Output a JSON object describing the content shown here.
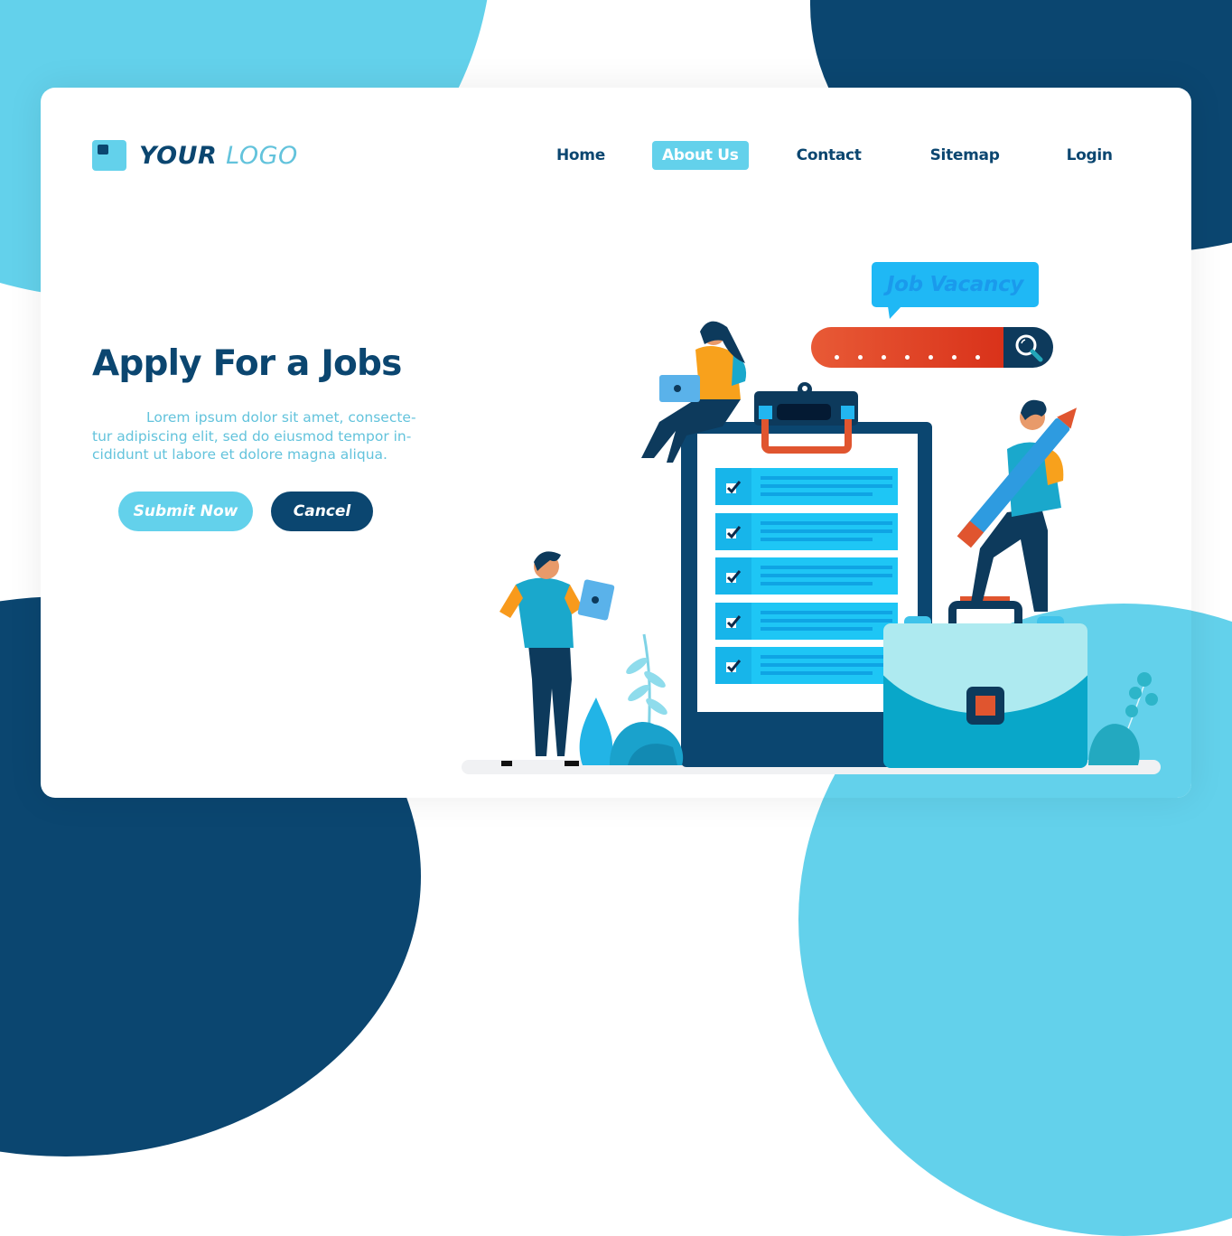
{
  "brand": {
    "logo_bold": "YOUR",
    "logo_light": "LOGO",
    "logo_icon": "logo-square-icon"
  },
  "nav": {
    "items": [
      {
        "label": "Home",
        "active": false
      },
      {
        "label": "About Us",
        "active": true
      },
      {
        "label": "Contact",
        "active": false
      },
      {
        "label": "Sitemap",
        "active": false
      },
      {
        "label": "Login",
        "active": false
      }
    ]
  },
  "hero": {
    "title": "Apply For a Jobs",
    "body": "Lorem ipsum dolor sit amet, consecte-tur adipiscing elit, sed do eiusmod tempor in-cididunt ut labore et dolore magna aliqua.",
    "submit_label": "Submit Now",
    "cancel_label": "Cancel"
  },
  "illustration": {
    "speech_bubble_text": "Job Vacancy",
    "search_placeholder_dots": 7,
    "search_icon": "magnifier-icon",
    "checklist_items_checked": [
      true,
      true,
      true,
      true,
      true
    ]
  },
  "colors": {
    "primary_dark": "#0b4670",
    "primary_light": "#63d1eb",
    "accent_orange": "#e0552f",
    "text_light": "#63c3dc",
    "bubble_blue": "#1fb8f5"
  }
}
